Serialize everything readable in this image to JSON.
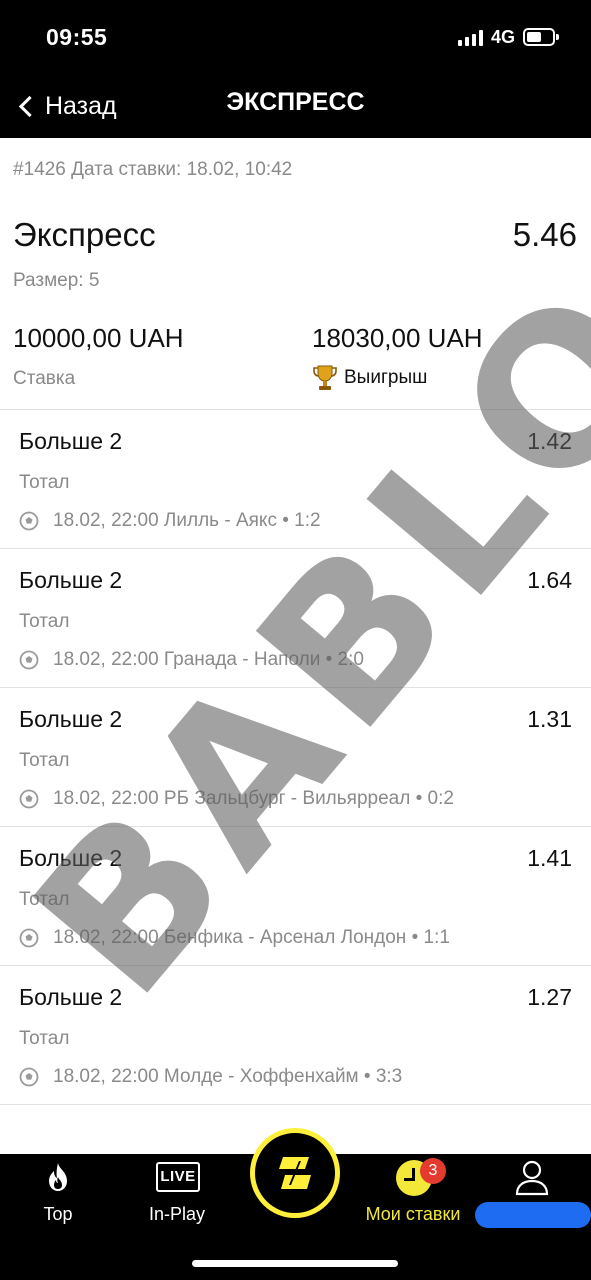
{
  "status_bar": {
    "time": "09:55",
    "network": "4G"
  },
  "nav": {
    "back_label": "Назад",
    "title": "ЭКСПРЕСС"
  },
  "bet": {
    "meta": "#1426 Дата ставки: 18.02, 10:42",
    "type": "Экспресс",
    "total_odds": "5.46",
    "size": "Размер: 5",
    "stake_amount": "10000,00 UAH",
    "stake_label": "Ставка",
    "win_amount": "18030,00 UAH",
    "win_label": "Выигрыш"
  },
  "legs": [
    {
      "selection": "Больше 2",
      "odds": "1.42",
      "market": "Тотал",
      "event": "18.02, 22:00 Лилль - Аякс • 1:2"
    },
    {
      "selection": "Больше 2",
      "odds": "1.64",
      "market": "Тотал",
      "event": "18.02, 22:00 Гранада - Наполи • 2:0"
    },
    {
      "selection": "Больше 2",
      "odds": "1.31",
      "market": "Тотал",
      "event": "18.02, 22:00 РБ Зальцбург - Вильярреал • 0:2"
    },
    {
      "selection": "Больше 2",
      "odds": "1.41",
      "market": "Тотал",
      "event": "18.02, 22:00 Бенфика - Арсенал Лондон • 1:1"
    },
    {
      "selection": "Больше 2",
      "odds": "1.27",
      "market": "Тотал",
      "event": "18.02, 22:00 Молде - Хоффенхайм • 3:3"
    }
  ],
  "watermark": "BABLO",
  "tab_bar": {
    "top_label": "Top",
    "inplay_label": "In-Play",
    "live_text": "LIVE",
    "bets_label": "Мои ставки",
    "bets_badge": "3"
  },
  "colors": {
    "accent_yellow": "#f3e83a",
    "badge_red": "#e33c2f",
    "profile_blue": "#1e6cf2",
    "header_black": "#000000"
  }
}
